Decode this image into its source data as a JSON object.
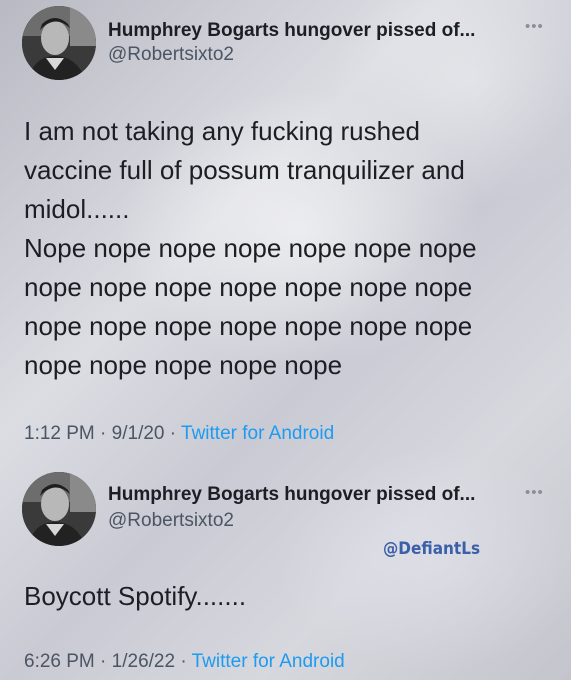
{
  "tweets": [
    {
      "author": {
        "display_name": "Humphrey Bogarts hungover pissed of...",
        "handle": "@Robertsixto2",
        "avatar": "avatar-photo"
      },
      "more_icon": "more-options-icon",
      "text_lines": [
        "I am not taking any fucking rushed",
        "vaccine full of possum tranquilizer and",
        "midol......",
        "Nope nope nope nope nope nope nope",
        "nope nope nope nope nope nope nope",
        "nope nope nope nope nope nope nope",
        "nope nope nope nope nope"
      ],
      "time": "1:12 PM",
      "separator": "·",
      "date": "9/1/20",
      "source": "Twitter for Android"
    },
    {
      "author": {
        "display_name": "Humphrey Bogarts hungover pissed of...",
        "handle": "@Robertsixto2",
        "avatar": "avatar-photo"
      },
      "more_icon": "more-options-icon",
      "text_lines": [
        "Boycott Spotify......."
      ],
      "time": "6:26 PM",
      "separator": "·",
      "date": "1/26/22",
      "source": "Twitter for Android"
    }
  ],
  "watermark": "@DefiantLs",
  "colors": {
    "link": "#1d9bf0",
    "text": "#1b1f23",
    "secondary": "#4b5563",
    "watermark": "#3b5fa8"
  }
}
